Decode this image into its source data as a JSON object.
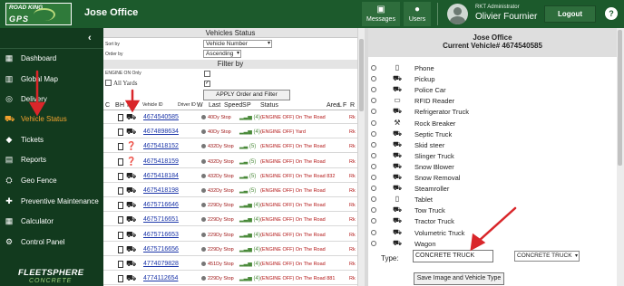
{
  "header": {
    "logo_top": "ROAD KING",
    "logo_bottom": "GPS",
    "title": "Jose Office",
    "messages_label": "Messages",
    "users_label": "Users",
    "user_role": "RKT Administrator",
    "user_name": "Olivier Fournier",
    "logout_label": "Logout",
    "help_label": "?"
  },
  "sidebar": {
    "collapse_icon": "‹",
    "items": [
      {
        "label": "Dashboard",
        "icon": "▦"
      },
      {
        "label": "Global Map",
        "icon": "▥"
      },
      {
        "label": "Delivery",
        "icon": "◎"
      },
      {
        "label": "Vehicle Status",
        "icon": "⛟"
      },
      {
        "label": "Tickets",
        "icon": "◆"
      },
      {
        "label": "Reports",
        "icon": "▤"
      },
      {
        "label": "Geo Fence",
        "icon": "⛭"
      },
      {
        "label": "Preventive Maintenance",
        "icon": "✚"
      },
      {
        "label": "Calculator",
        "icon": "▦"
      },
      {
        "label": "Control Panel",
        "icon": "⚙"
      }
    ],
    "active_index": 3,
    "brand": "FLEETSPHERE",
    "brand_sub": "CONCRETE"
  },
  "vehicles_status": {
    "title": "Vehicles Status",
    "sort_by_label": "Sort by",
    "sort_by_value": "Vehicle Number",
    "order_by_label": "Order by",
    "order_by_value": "Ascending",
    "filter_title": "Filter by",
    "engine_on_label": "ENGINE ON Only",
    "engine_on_checked": false,
    "all_yards_label": "All Yards",
    "all_yards_checked": true,
    "apply_label": "APPLY Order and Filter",
    "columns": [
      "C",
      "B",
      "H",
      "I",
      "Vehicle ID",
      "Driver ID",
      "W",
      "Last",
      "Speed",
      "S",
      "P",
      "Status",
      "Area",
      "L",
      "F",
      "R"
    ],
    "rows": [
      {
        "vehicle_id": "4674540585",
        "icon": "⛟",
        "last": "40Dy Stop",
        "bars": "▂▃▅ (4)",
        "status": "(ENGINE OFF) On The Road",
        "r": "Rk"
      },
      {
        "vehicle_id": "4674898634",
        "icon": "⛟",
        "last": "40Dy Stop",
        "bars": "▂▃▅ (4)",
        "status": "(ENGINE OFF) Yard",
        "r": "Rk"
      },
      {
        "vehicle_id": "4675418152",
        "icon": "❓",
        "last": "432Dy Stop",
        "bars": "▂▃ (5)",
        "status": "(ENGINE OFF) On The Road",
        "r": "Rk"
      },
      {
        "vehicle_id": "4675418159",
        "icon": "❓",
        "last": "432Dy Stop",
        "bars": "▂▃ (5)",
        "status": "(ENGINE OFF) On The Road",
        "r": "Rk"
      },
      {
        "vehicle_id": "4675418184",
        "icon": "⛟",
        "last": "432Dy Stop",
        "bars": "▂▃ (5)",
        "status": "(ENGINE OFF) On The Road 832",
        "r": "Rk"
      },
      {
        "vehicle_id": "4675418198",
        "icon": "⛟",
        "last": "432Dy Stop",
        "bars": "▂▃ (5)",
        "status": "(ENGINE OFF) On The Road",
        "r": "Rk"
      },
      {
        "vehicle_id": "4675716646",
        "icon": "⛟",
        "last": "229Dy Stop",
        "bars": "▂▃▅ (4)",
        "status": "(ENGINE OFF) On The Road",
        "r": "Rk"
      },
      {
        "vehicle_id": "4675716651",
        "icon": "⛟",
        "last": "229Dy Stop",
        "bars": "▂▃▅ (4)",
        "status": "(ENGINE OFF) On The Road",
        "r": "Rk"
      },
      {
        "vehicle_id": "4675716653",
        "icon": "⛟",
        "last": "229Dy Stop",
        "bars": "▂▃▅ (4)",
        "status": "(ENGINE OFF) On The Road",
        "r": "Rk"
      },
      {
        "vehicle_id": "4675716656",
        "icon": "⛟",
        "last": "229Dy Stop",
        "bars": "▂▃▅ (4)",
        "status": "(ENGINE OFF) On The Road",
        "r": "Rk"
      },
      {
        "vehicle_id": "4774079828",
        "icon": "⛟",
        "last": "451Dy Stop",
        "bars": "▂▃▅ (4)",
        "status": "(ENGINE OFF) On The Road",
        "r": "Rk"
      },
      {
        "vehicle_id": "4774112654",
        "icon": "⛟",
        "last": "229Dy Stop",
        "bars": "▂▃▅ (4)",
        "status": "(ENGINE OFF) On The Road 881",
        "r": "Rk"
      }
    ]
  },
  "vehicle_panel": {
    "title": "Jose Office",
    "subtitle": "Current Vehicle# 4674540585",
    "types": [
      {
        "label": "Phone",
        "icon": "▯"
      },
      {
        "label": "Pickup",
        "icon": "⛟"
      },
      {
        "label": "Police Car",
        "icon": "⛟"
      },
      {
        "label": "RFID Reader",
        "icon": "▭"
      },
      {
        "label": "Refrigerator Truck",
        "icon": "⛟"
      },
      {
        "label": "Rock Breaker",
        "icon": "⚒"
      },
      {
        "label": "Septic Truck",
        "icon": "⛟"
      },
      {
        "label": "Skid steer",
        "icon": "⛟"
      },
      {
        "label": "Slinger Truck",
        "icon": "⛟"
      },
      {
        "label": "Snow Blower",
        "icon": "⛟"
      },
      {
        "label": "Snow Removal",
        "icon": "⛟"
      },
      {
        "label": "Steamroller",
        "icon": "⛟"
      },
      {
        "label": "Tablet",
        "icon": "▯"
      },
      {
        "label": "Tow Truck",
        "icon": "⛟"
      },
      {
        "label": "Tractor Truck",
        "icon": "⛟"
      },
      {
        "label": "Volumetric Truck",
        "icon": "⛟"
      },
      {
        "label": "Wagon",
        "icon": "⛟"
      }
    ],
    "type_label": "Type:",
    "type_value": "CONCRETE TRUCK",
    "type_select_value": "CONCRETE TRUCK",
    "save_label": "Save Image and Vehicle Type"
  },
  "colors": {
    "brand_green": "#1c5a2c",
    "sidebar_bg": "#123a1e",
    "active_orange": "#f2a22f",
    "status_red": "#b31717",
    "link_blue": "#1b35a8",
    "annotation_red": "#d9262a"
  }
}
